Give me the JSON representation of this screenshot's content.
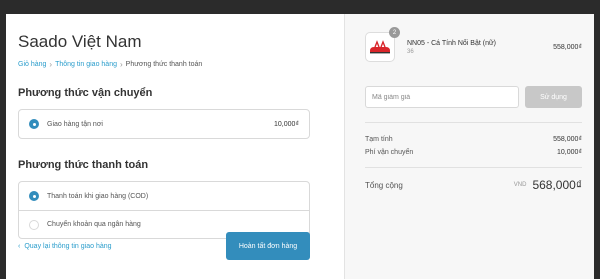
{
  "header": {
    "store_title": "Saado Việt Nam",
    "breadcrumb": [
      {
        "label": "Giỏ hàng"
      },
      {
        "label": "Thông tin giao hàng"
      },
      {
        "label": "Phương thức thanh toán"
      }
    ]
  },
  "shipping": {
    "title": "Phương thức vận chuyển",
    "options": [
      {
        "label": "Giao hàng tận nơi",
        "price": "10,000₫",
        "selected": true
      }
    ]
  },
  "payment": {
    "title": "Phương thức thanh toán",
    "options": [
      {
        "label": "Thanh toán khi giao hàng (COD)",
        "selected": true
      },
      {
        "label": "Chuyển khoản qua ngân hàng",
        "selected": false
      }
    ]
  },
  "footer": {
    "back_label": "Quay lại thông tin giao hàng",
    "submit_label": "Hoàn tất đơn hàng"
  },
  "order": {
    "product": {
      "quantity": "2",
      "name": "NN05 - Cá Tính Nổi Bật (nữ)",
      "variant": "36",
      "price": "558,000₫",
      "thumb_icon": "red-sandal-image"
    },
    "discount": {
      "placeholder": "Mã giảm giá",
      "apply_label": "Sử dụng"
    },
    "lines": [
      {
        "label": "Tạm tính",
        "value": "558,000₫"
      },
      {
        "label": "Phí vận chuyển",
        "value": "10,000₫"
      }
    ],
    "total": {
      "label": "Tổng cộng",
      "currency": "VND",
      "amount": "568,000₫"
    }
  },
  "colors": {
    "accent": "#338dbc",
    "link": "#2a9dcc",
    "sandal": "#d9262b"
  }
}
